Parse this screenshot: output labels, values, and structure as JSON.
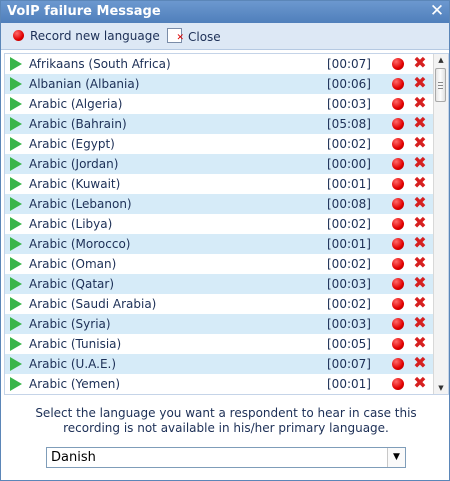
{
  "window": {
    "title": "VoIP failure Message",
    "close_glyph": "✕"
  },
  "toolbar": {
    "record_label": "Record new language",
    "close_label": "Close"
  },
  "languages": [
    {
      "name": "Afrikaans (South Africa)",
      "duration": "[00:07]"
    },
    {
      "name": "Albanian (Albania)",
      "duration": "[00:06]"
    },
    {
      "name": "Arabic (Algeria)",
      "duration": "[00:03]"
    },
    {
      "name": "Arabic (Bahrain)",
      "duration": "[05:08]"
    },
    {
      "name": "Arabic (Egypt)",
      "duration": "[00:02]"
    },
    {
      "name": "Arabic (Jordan)",
      "duration": "[00:00]"
    },
    {
      "name": "Arabic (Kuwait)",
      "duration": "[00:01]"
    },
    {
      "name": "Arabic (Lebanon)",
      "duration": "[00:08]"
    },
    {
      "name": "Arabic (Libya)",
      "duration": "[00:02]"
    },
    {
      "name": "Arabic (Morocco)",
      "duration": "[00:01]"
    },
    {
      "name": "Arabic (Oman)",
      "duration": "[00:02]"
    },
    {
      "name": "Arabic (Qatar)",
      "duration": "[00:03]"
    },
    {
      "name": "Arabic (Saudi Arabia)",
      "duration": "[00:02]"
    },
    {
      "name": "Arabic (Syria)",
      "duration": "[00:03]"
    },
    {
      "name": "Arabic (Tunisia)",
      "duration": "[00:05]"
    },
    {
      "name": "Arabic (U.A.E.)",
      "duration": "[00:07]"
    },
    {
      "name": "Arabic (Yemen)",
      "duration": "[00:01]"
    }
  ],
  "row_icons": {
    "play": "play-icon",
    "record": "record-icon",
    "delete": "delete-icon"
  },
  "help_text": "Select the language you want a respondent to hear in case this recording is not available in his/her primary language.",
  "fallback_select": {
    "value": "Danish"
  },
  "colors": {
    "title_bar": "#5a89c4",
    "row_alt": "#d6ebf8",
    "record_red": "#e00000",
    "play_green": "#39b54a",
    "delete_red": "#d62020"
  }
}
